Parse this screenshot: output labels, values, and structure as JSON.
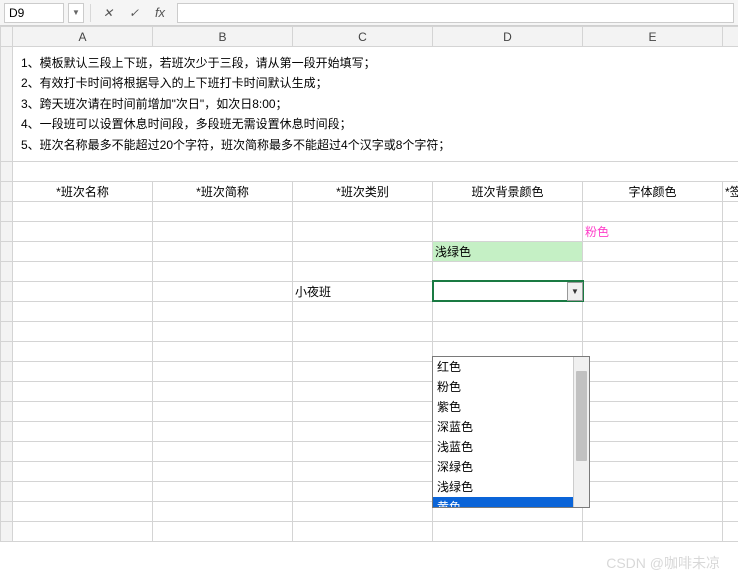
{
  "toolbar": {
    "namebox_value": "D9",
    "fx_label": "fx"
  },
  "columns": [
    "A",
    "B",
    "C",
    "D",
    "E"
  ],
  "notes": {
    "line1": "1、模板默认三段上下班，若班次少于三段，请从第一段开始填写；",
    "line2": "2、有效打卡时间将根据导入的上下班打卡时间默认生成；",
    "line3": "3、跨天班次请在时间前增加\"次日\"，如次日8:00；",
    "line4": "4、一段班可以设置休息时间段，多段班无需设置休息时间段；",
    "line5": "5、班次名称最多不能超过20个字符，班次简称最多不能超过4个汉字或8个字符；"
  },
  "headers": {
    "c1": "*班次名称",
    "c2": "*班次简称",
    "c3": "*班次类别",
    "c4": "班次背景颜色",
    "c5": "字体颜色",
    "c6": "*签"
  },
  "cells": {
    "e6": "粉色",
    "d7": "浅绿色",
    "c9": "小夜班"
  },
  "dropdown": {
    "items": [
      "红色",
      "粉色",
      "紫色",
      "深蓝色",
      "浅蓝色",
      "深绿色",
      "浅绿色",
      "黄色"
    ],
    "selected_index": 7
  },
  "watermark": "CSDN @咖啡未凉"
}
